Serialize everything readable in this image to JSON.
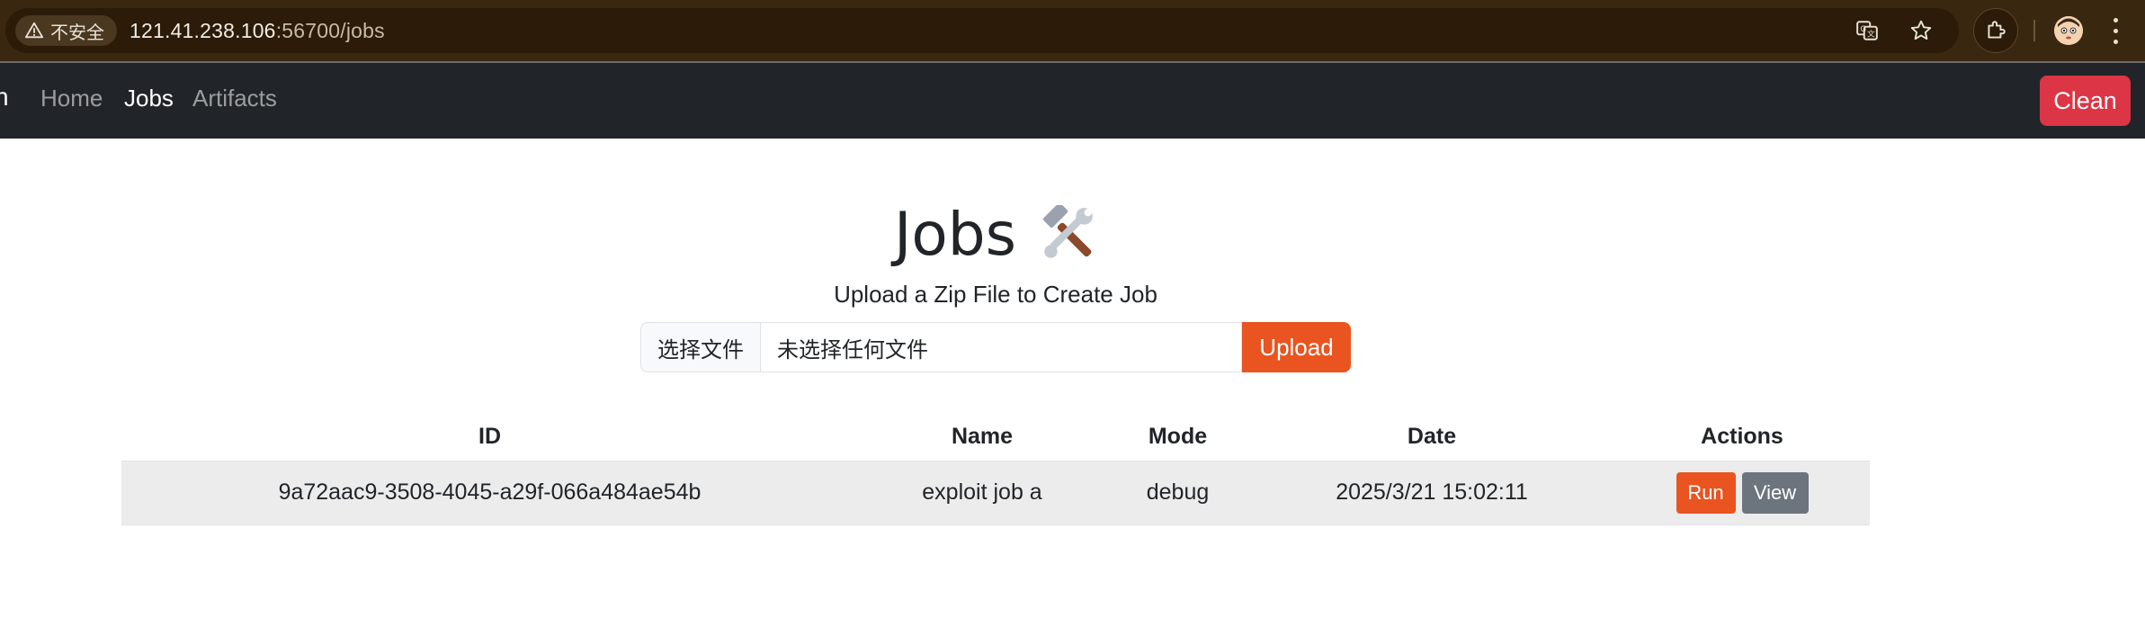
{
  "browser": {
    "security_label": "不安全",
    "url_host": "121.41.238.106",
    "url_path": ":56700/jobs"
  },
  "navbar": {
    "brand_fragment": "n",
    "links": [
      {
        "label": "Home"
      },
      {
        "label": "Jobs"
      },
      {
        "label": "Artifacts"
      }
    ],
    "clean_label": "Clean"
  },
  "main": {
    "title": "Jobs",
    "title_icon": "hammer-and-wrench-icon",
    "subtitle": "Upload a Zip File to Create Job",
    "file_button_label": "选择文件",
    "file_status": "未选择任何文件",
    "upload_label": "Upload"
  },
  "table": {
    "headers": [
      "ID",
      "Name",
      "Mode",
      "Date",
      "Actions"
    ],
    "rows": [
      {
        "id": "9a72aac9-3508-4045-a29f-066a484ae54b",
        "name": "exploit job a",
        "mode": "debug",
        "date": "2025/3/21 15:02:11",
        "run_label": "Run",
        "view_label": "View"
      }
    ]
  },
  "colors": {
    "navbar_bg": "#212529",
    "accent_orange": "#e95420",
    "danger_red": "#dc3545",
    "secondary_gray": "#6c757d"
  }
}
